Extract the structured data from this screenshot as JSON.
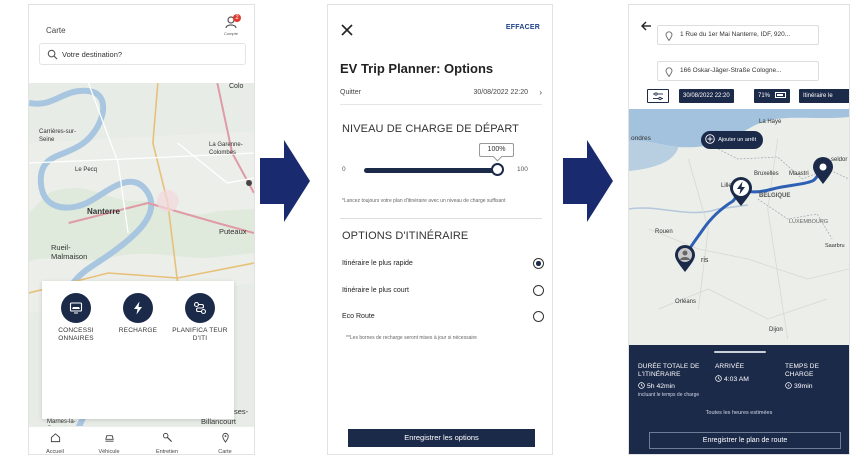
{
  "screen1": {
    "title": "Carte",
    "account_label": "Compte",
    "account_badge": "2",
    "search_placeholder": "Votre destination?",
    "map_labels": [
      "Colo",
      "Carrières-sur-Seine",
      "La Garenne-Colombes",
      "Nanterre",
      "Puteaux",
      "Rueil-Malmaison",
      "Marnes-la-Coquette",
      "Billancourt",
      "Le Pecq",
      "ses-"
    ],
    "actions": [
      {
        "label": "CONCESSI ONNAIRES",
        "icon": "dealer-icon"
      },
      {
        "label": "RECHARGE",
        "icon": "charging-bolt-icon"
      },
      {
        "label": "PLANIFICA TEUR D'ITI",
        "icon": "route-planner-icon"
      }
    ],
    "tabs": [
      {
        "label": "Accueil",
        "icon": "home-icon"
      },
      {
        "label": "Véhicule",
        "icon": "car-icon"
      },
      {
        "label": "Entretien",
        "icon": "wrench-icon"
      },
      {
        "label": "Carte",
        "icon": "map-pin-icon"
      }
    ]
  },
  "screen2": {
    "close_icon": "close-icon",
    "clear_label": "EFFACER",
    "title": "EV Trip Planner: Options",
    "quit_label": "Quitter",
    "quit_value": "30/08/2022 22:20",
    "charge_section": "NIVEAU DE CHARGE DE DÉPART",
    "slider": {
      "min": "0",
      "max": "100",
      "value": "100%",
      "level": 1.0
    },
    "charge_note": "*Lancez toujours votre plan d'itinéraire avec un niveau de charge suffisant",
    "route_section": "OPTIONS D'ITINÉRAIRE",
    "options": [
      {
        "label": "Itinéraire le plus rapide",
        "selected": true
      },
      {
        "label": "Itinéraire le plus court",
        "selected": false
      },
      {
        "label": "Eco Route",
        "selected": false
      }
    ],
    "options_note": "**Les bornes de recharge seront mises à jour si nécessaire",
    "save_button": "Enregistrer les options"
  },
  "screen3": {
    "origin": "1 Rue du 1er Mai Nanterre, IDF, 920...",
    "destination": "166 Oskar-Jäger-Straße Cologne...",
    "chips": [
      "30/08/2022 22:20",
      "71%",
      "Itinéraire le"
    ],
    "add_stop": "Ajouter un arrêt",
    "map_labels": [
      "La Haye",
      "ondres",
      "Bruxelles",
      "Maastri",
      "BELGIQUE",
      "LUXEMBOURG",
      "Lille",
      "Rouen",
      "ris",
      "Orléans",
      "Dijon",
      "seldor",
      "Saarbru"
    ],
    "stats": [
      {
        "heading": "DURÉE TOTALE DE L'ITINÉRAIRE",
        "value": "5h 42min",
        "sub": "incluant le temps de charge"
      },
      {
        "heading": "ARRIVÉE",
        "value": "4:03 AM"
      },
      {
        "heading": "TEMPS DE CHARGE",
        "value": "39min"
      }
    ],
    "estimated_note": "Toutes les heures estimées",
    "save_button": "Enregistrer le plan de route"
  },
  "colors": {
    "navy": "#1c2a4a",
    "route_blue": "#2d5fb4",
    "badge_red": "#e03b2e"
  }
}
